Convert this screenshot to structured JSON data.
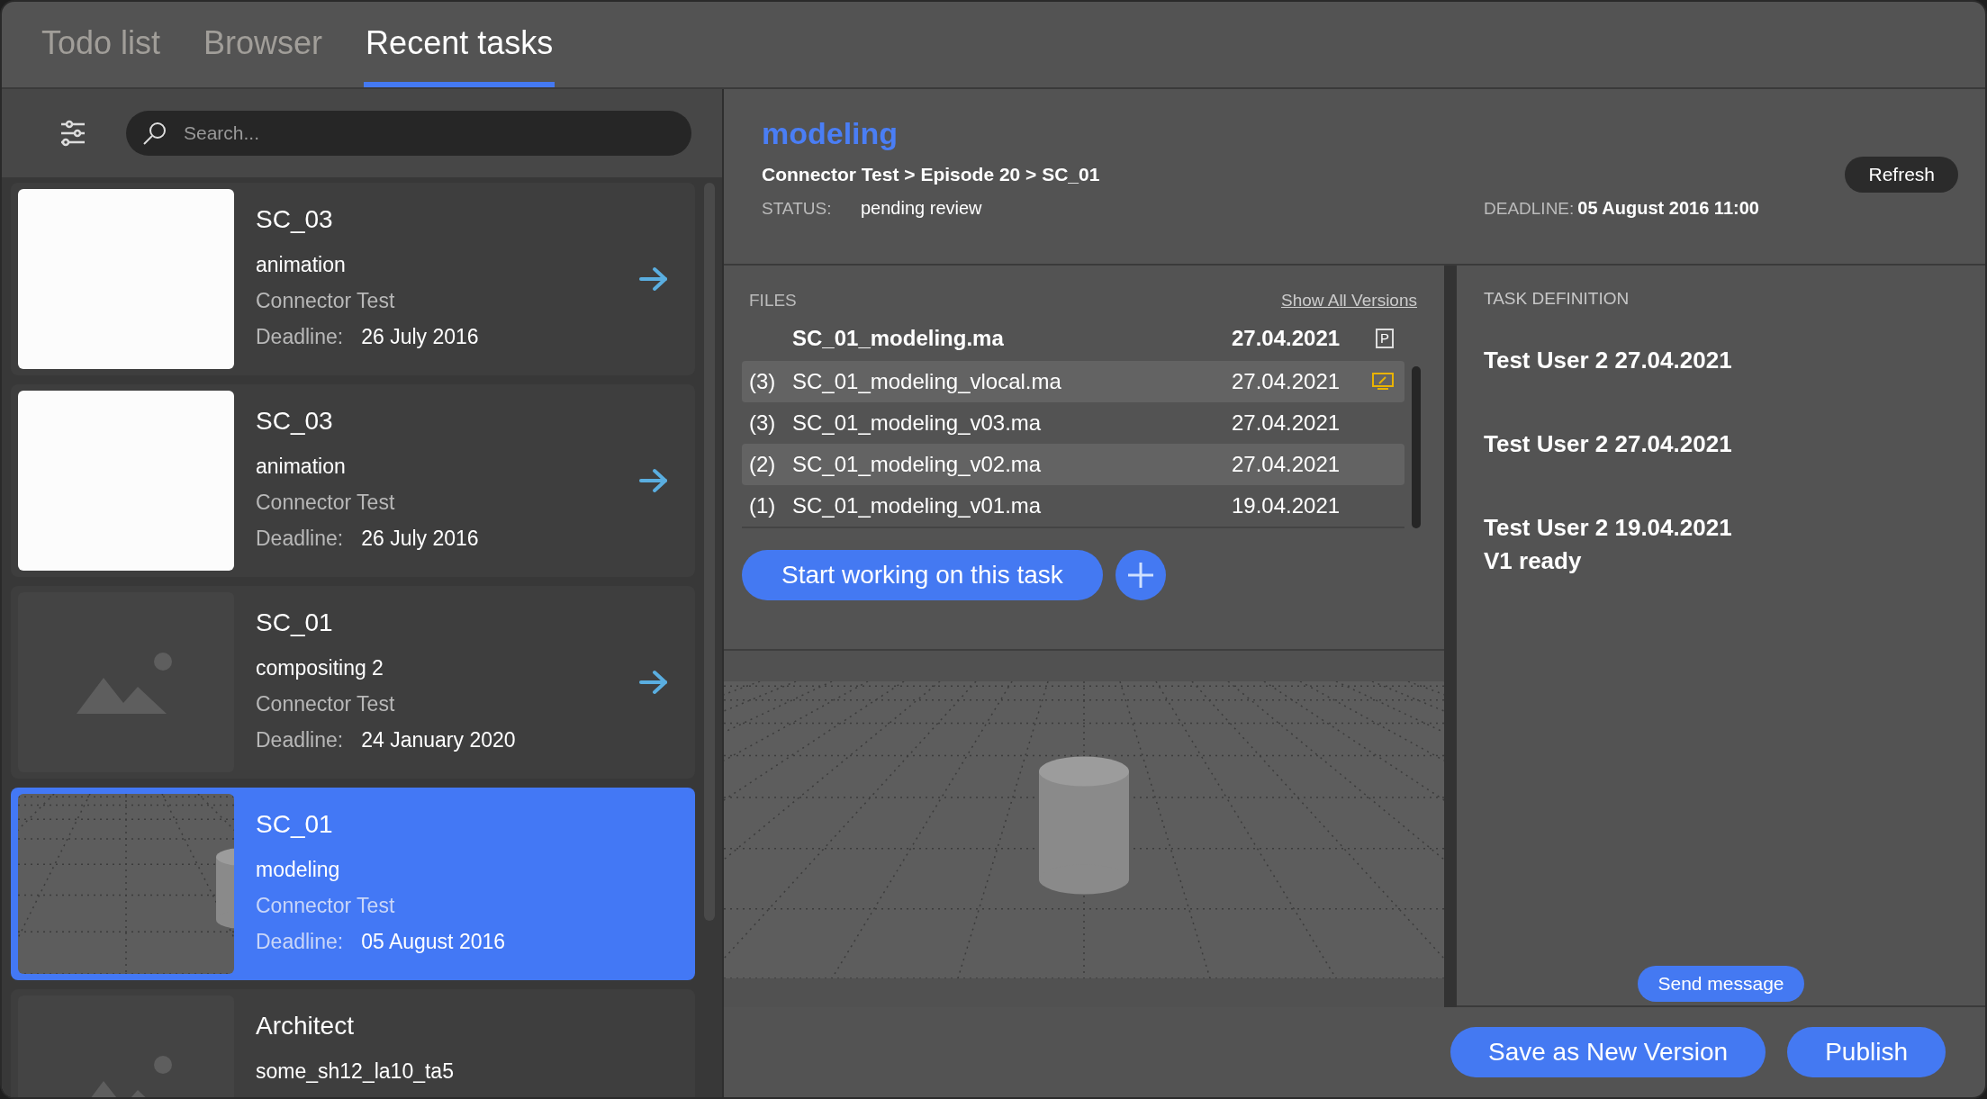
{
  "tabs": [
    {
      "label": "Todo list",
      "selected": false
    },
    {
      "label": "Browser",
      "selected": false
    },
    {
      "label": "Recent tasks",
      "selected": true
    }
  ],
  "search": {
    "placeholder": "Search..."
  },
  "tasks": [
    {
      "title": "SC_03",
      "step": "animation",
      "project": "Connector Test",
      "deadline_label": "Deadline:",
      "deadline": "26 July 2016",
      "kind": "blank",
      "arrow": true,
      "selected": false
    },
    {
      "title": "SC_03",
      "step": "animation",
      "project": "Connector Test",
      "deadline_label": "Deadline:",
      "deadline": "26 July 2016",
      "kind": "blank",
      "arrow": true,
      "selected": false
    },
    {
      "title": "SC_01",
      "step": "compositing 2",
      "project": "Connector Test",
      "deadline_label": "Deadline:",
      "deadline": "24 January 2020",
      "kind": "placeholder",
      "arrow": true,
      "selected": false
    },
    {
      "title": "SC_01",
      "step": "modeling",
      "project": "Connector Test",
      "deadline_label": "Deadline:",
      "deadline": "05 August 2016",
      "kind": "picture",
      "arrow": false,
      "selected": true
    },
    {
      "title": "Architect",
      "step": "some_sh12_la10_ta5",
      "kind": "placeholder",
      "arrow": false,
      "selected": false
    }
  ],
  "task": {
    "title": "modeling",
    "breadcrumb": "Connector Test > Episode 20 > SC_01",
    "refresh": "Refresh",
    "status_label": "STATUS:",
    "status": "pending review",
    "deadline_label": "DEADLINE:",
    "deadline": "05 August 2016 11:00"
  },
  "files": {
    "heading": "FILES",
    "show_all": "Show All Versions",
    "main": {
      "name": "SC_01_modeling.ma",
      "date": "27.04.2021",
      "badge": "P"
    },
    "versions": [
      {
        "number": "(3)",
        "name": "SC_01_modeling_vlocal.ma",
        "date": "27.04.2021",
        "selected": true,
        "kind": "local"
      },
      {
        "number": "(3)",
        "name": "SC_01_modeling_v03.ma",
        "date": "27.04.2021",
        "selected": false,
        "kind": "version"
      },
      {
        "number": "(2)",
        "name": "SC_01_modeling_v02.ma",
        "date": "27.04.2021",
        "selected": true,
        "kind": "version"
      },
      {
        "number": "(1)",
        "name": "SC_01_modeling_v01.ma",
        "date": "19.04.2021",
        "selected": false,
        "kind": "version"
      }
    ],
    "start_button": "Start working on this task"
  },
  "task_definition": {
    "heading": "TASK DEFINITION",
    "notes": [
      {
        "header": "Test User 2 27.04.2021"
      },
      {
        "header": "Test User 2 27.04.2021"
      },
      {
        "header": "Test User 2 19.04.2021",
        "body": "V1 ready"
      }
    ],
    "send_button": "Send message"
  },
  "footer": {
    "buttons": [
      "Save as New Version",
      "Publish"
    ]
  }
}
